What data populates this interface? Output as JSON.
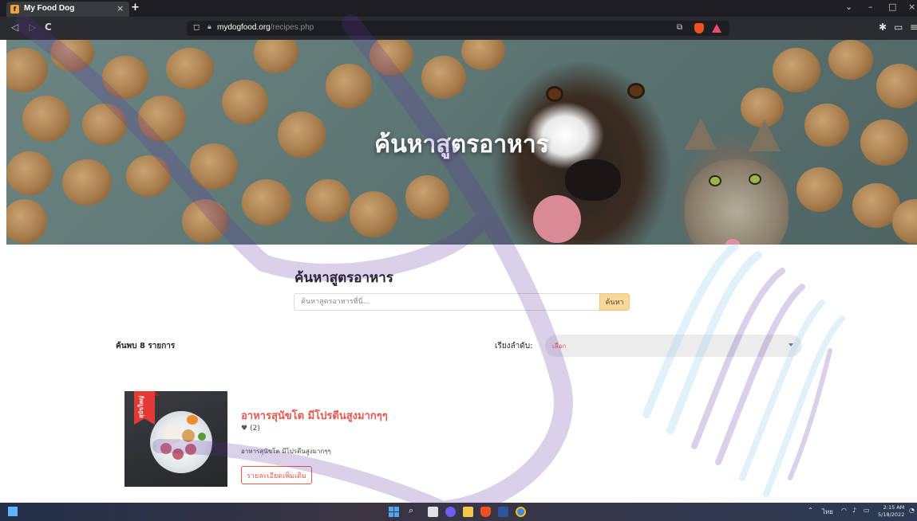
{
  "browser": {
    "tab_title": "My Food Dog",
    "tab_close": "×",
    "new_tab": "+",
    "url_domain": "mydogfood.org",
    "url_path": "/recipes.php",
    "nav_back": "◁",
    "nav_forward": "▷",
    "nav_reload": "C",
    "window_min": "–",
    "window_restore": "□",
    "window_close": "×",
    "tab_dropdown": "⌄"
  },
  "hero": {
    "title": "ค้นหาสูตรอาหาร"
  },
  "search": {
    "title": "ค้นหาสูตรอาหาร",
    "placeholder": "ค้นหาสูตรอาหารที่นี่...",
    "button_label": "ค้นหา"
  },
  "results": {
    "count_text": "ค้นพบ 8 รายการ",
    "sort_label": "เรียงลำดับ:",
    "sort_selected": "เลือก"
  },
  "recipes": [
    {
      "badge": "สุนัขใหญ่",
      "name": "อาหารสุนัขโต มีโปรตีนสูงมากๆๆ",
      "likes": "(2)",
      "description": "อาหารสุนัขโต มีโปรตีนสูงมากๆๆ",
      "detail_button": "รายละเอียดเพิ่มเติม"
    }
  ],
  "taskbar": {
    "language": "ไทย",
    "time": "2:15 AM",
    "date": "5/18/2022"
  },
  "colors": {
    "accent": "#e8584e",
    "search_button": "#f7d79a",
    "badge": "#e53935",
    "watermark_purple": "#5b2ca0",
    "watermark_blue": "#7cc4ea"
  }
}
